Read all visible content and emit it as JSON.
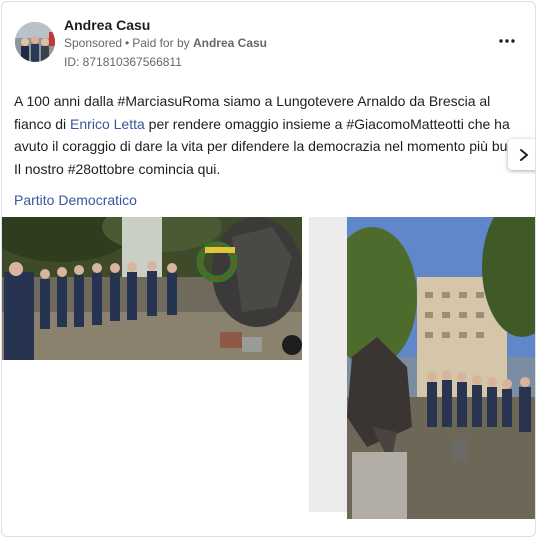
{
  "advertiser": {
    "name": "Andrea Casu",
    "sponsored_label": "Sponsored",
    "separator": "•",
    "paid_for_label": "Paid for by",
    "paid_for_name": "Andrea Casu",
    "id_label": "ID: 871810367566811"
  },
  "icons": {
    "more": "more-horizontal-icon",
    "next": "chevron-right-icon"
  },
  "message": {
    "part1": "A 100 anni dalla #MarciasuRoma siamo a Lungotevere Arnaldo da Brescia al fianco di ",
    "mention": "Enrico Letta",
    "part2": " per rendere omaggio insieme a #GiacomoMatteotti che ha avuto il coraggio di dare la vita per difendere la democrazia nel momento più buio.",
    "part3": "Il nostro #28ottobre comincia qui."
  },
  "page_link": "Partito Democratico",
  "colors": {
    "link": "#385898",
    "text": "#1c1e21",
    "secondary": "#65676b",
    "border": "#dddfe2"
  }
}
